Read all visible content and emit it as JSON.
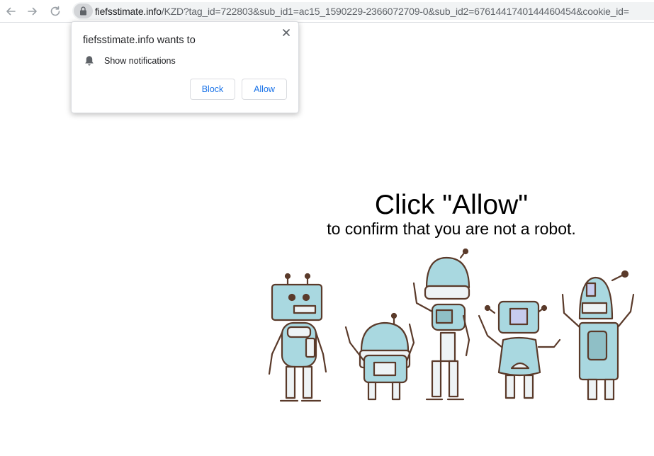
{
  "browser": {
    "url_host": "fiefsstimate.info",
    "url_rest": "/KZD?tag_id=722803&sub_id1=ac15_1590229-2366072709-0&sub_id2=6761441740144460454&cookie_id=",
    "back_icon": "arrow-left-icon",
    "forward_icon": "arrow-right-icon",
    "reload_icon": "reload-icon",
    "lock_icon": "lock-icon"
  },
  "prompt": {
    "title": "fiefsstimate.info wants to",
    "permission_icon": "bell-icon",
    "permission_label": "Show notifications",
    "block_label": "Block",
    "allow_label": "Allow",
    "close_icon": "close-icon"
  },
  "page": {
    "headline": "Click \"Allow\"",
    "subline": "to confirm that you are not a robot.",
    "illustration": "robots-illustration"
  },
  "colors": {
    "accent": "#1a73e8",
    "robot_fill": "#a9d8e0",
    "robot_outline": "#5a3a2a"
  }
}
